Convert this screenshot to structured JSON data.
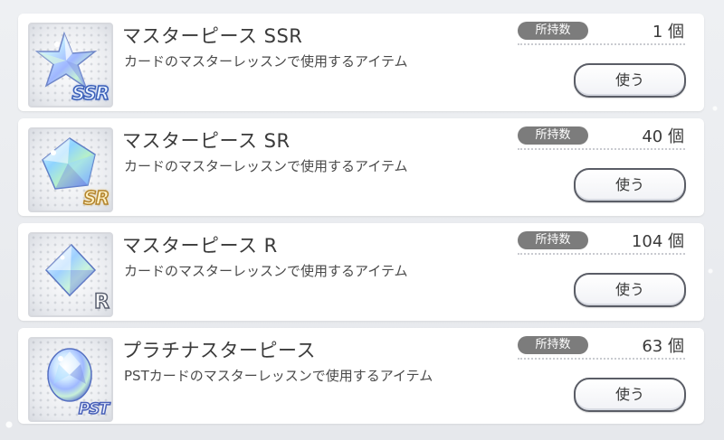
{
  "owned_label": "所持数",
  "use_label": "使う",
  "items": [
    {
      "name": "マスターピース SSR",
      "description": "カードのマスターレッスンで使用するアイテム",
      "count": "1 個",
      "rarity_tag": "SSR",
      "icon": "star-crystal-icon"
    },
    {
      "name": "マスターピース SR",
      "description": "カードのマスターレッスンで使用するアイテム",
      "count": "40 個",
      "rarity_tag": "SR",
      "icon": "pentagon-crystal-icon"
    },
    {
      "name": "マスターピース R",
      "description": "カードのマスターレッスンで使用するアイテム",
      "count": "104 個",
      "rarity_tag": "R",
      "icon": "diamond-crystal-icon"
    },
    {
      "name": "プラチナスターピース",
      "description": "PSTカードのマスターレッスンで使用するアイテム",
      "count": "63 個",
      "rarity_tag": "PST",
      "icon": "oval-crystal-icon"
    }
  ],
  "colors": {
    "badge_bg": "#7c7c7c",
    "button_border": "#5a5d66",
    "card_bg": "#ffffff",
    "page_bg": "#e9ebef"
  }
}
